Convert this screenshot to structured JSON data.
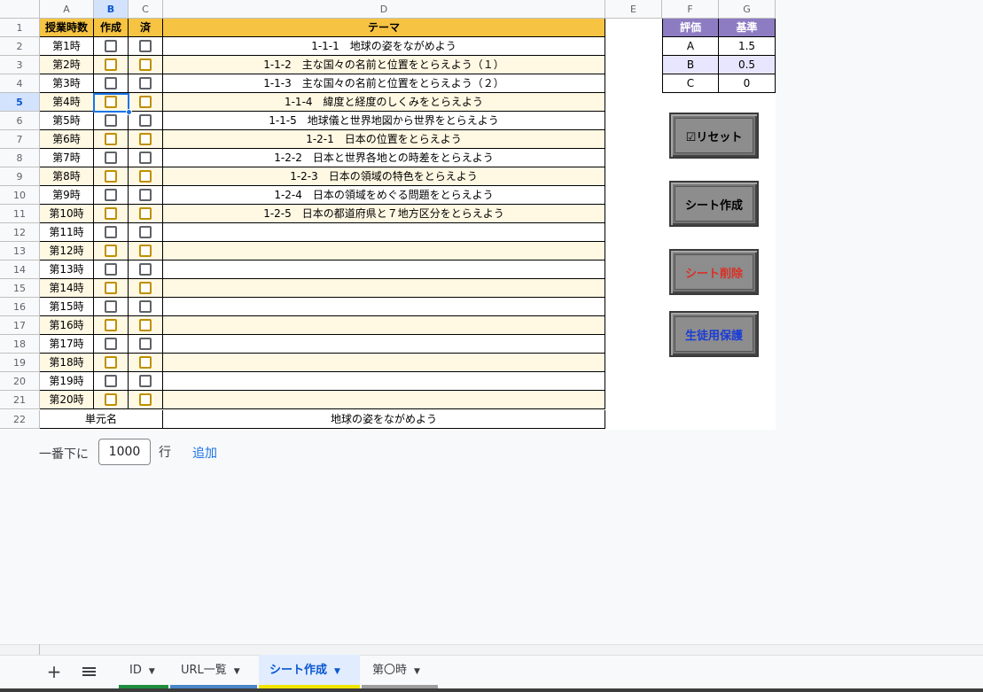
{
  "columns": [
    "A",
    "B",
    "C",
    "D",
    "E",
    "F",
    "G"
  ],
  "header": {
    "lessons": "授業時数",
    "created": "作成",
    "done": "済",
    "theme": "テーマ"
  },
  "rows": [
    {
      "num": "2",
      "lesson": "第1時",
      "theme": "1-1-1　地球の姿をながめよう"
    },
    {
      "num": "3",
      "lesson": "第2時",
      "theme": "1-1-2　主な国々の名前と位置をとらえよう（１）"
    },
    {
      "num": "4",
      "lesson": "第3時",
      "theme": "1-1-3　主な国々の名前と位置をとらえよう（２）"
    },
    {
      "num": "5",
      "lesson": "第4時",
      "theme": "1-1-4　緯度と経度のしくみをとらえよう"
    },
    {
      "num": "6",
      "lesson": "第5時",
      "theme": "1-1-5　地球儀と世界地図から世界をとらえよう"
    },
    {
      "num": "7",
      "lesson": "第6時",
      "theme": "1-2-1　日本の位置をとらえよう"
    },
    {
      "num": "8",
      "lesson": "第7時",
      "theme": "1-2-2　日本と世界各地との時差をとらえよう"
    },
    {
      "num": "9",
      "lesson": "第8時",
      "theme": "1-2-3　日本の領域の特色をとらえよう"
    },
    {
      "num": "10",
      "lesson": "第9時",
      "theme": "1-2-4　日本の領域をめぐる問題をとらえよう"
    },
    {
      "num": "11",
      "lesson": "第10時",
      "theme": "1-2-5　日本の都道府県と７地方区分をとらえよう"
    },
    {
      "num": "12",
      "lesson": "第11時",
      "theme": ""
    },
    {
      "num": "13",
      "lesson": "第12時",
      "theme": ""
    },
    {
      "num": "14",
      "lesson": "第13時",
      "theme": ""
    },
    {
      "num": "15",
      "lesson": "第14時",
      "theme": ""
    },
    {
      "num": "16",
      "lesson": "第15時",
      "theme": ""
    },
    {
      "num": "17",
      "lesson": "第16時",
      "theme": ""
    },
    {
      "num": "18",
      "lesson": "第17時",
      "theme": ""
    },
    {
      "num": "19",
      "lesson": "第18時",
      "theme": ""
    },
    {
      "num": "20",
      "lesson": "第19時",
      "theme": ""
    },
    {
      "num": "21",
      "lesson": "第20時",
      "theme": ""
    }
  ],
  "footer_row": {
    "num": "22",
    "label": "単元名",
    "value": "地球の姿をながめよう"
  },
  "row1_num": "1",
  "criteria": {
    "header": [
      "評価",
      "基準"
    ],
    "rows": [
      [
        "A",
        "1.5"
      ],
      [
        "B",
        "0.5"
      ],
      [
        "C",
        "0"
      ]
    ]
  },
  "buttons": {
    "reset": "☑リセット",
    "create": "シート作成",
    "delete": "シート削除",
    "protect": "生徒用保護"
  },
  "add_rows": {
    "prefix": "一番下に",
    "count": "1000",
    "suffix": "行",
    "action": "追加"
  },
  "tabs": [
    {
      "label": "ID",
      "color": "#1e8e3e"
    },
    {
      "label": "URL一覧",
      "color": "#4a86c8"
    },
    {
      "label": "シート作成",
      "color": "#f1e400"
    },
    {
      "label": "第〇時",
      "color": "#9e9e9e"
    }
  ],
  "colors": {
    "header_orange": "#f6c342",
    "stripe": "#fff8e3",
    "criteria_header": "#8e7cc3",
    "criteria_sel": "#e8e6ff"
  }
}
